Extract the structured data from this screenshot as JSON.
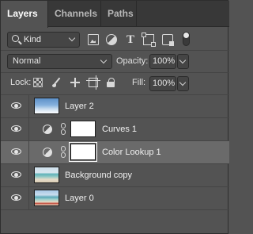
{
  "tabs": [
    {
      "label": "Layers",
      "active": true
    },
    {
      "label": "Channels",
      "active": false
    },
    {
      "label": "Paths",
      "active": false
    }
  ],
  "filter": {
    "kind_label": "Kind",
    "icons": [
      "pixel-filter-icon",
      "adjustment-filter-icon",
      "type-filter-icon",
      "shape-filter-icon",
      "smart-object-filter-icon",
      "filter-toggle-icon"
    ],
    "type_glyph": "T"
  },
  "blend": {
    "mode": "Normal",
    "opacity_label": "Opacity:",
    "opacity_value": "100%"
  },
  "lock": {
    "label": "Lock:",
    "icons": [
      "lock-transparent-icon",
      "lock-pixels-icon",
      "lock-position-icon",
      "lock-artboard-icon",
      "lock-all-icon"
    ],
    "fill_label": "Fill:",
    "fill_value": "100%"
  },
  "layers": [
    {
      "name": "Layer 2",
      "kind": "pixel",
      "visible": true,
      "selected": false
    },
    {
      "name": "Curves 1",
      "kind": "adjustment",
      "visible": true,
      "selected": false
    },
    {
      "name": "Color Lookup 1",
      "kind": "adjustment",
      "visible": true,
      "selected": true
    },
    {
      "name": "Background copy",
      "kind": "pixel",
      "visible": true,
      "selected": false
    },
    {
      "name": "Layer 0",
      "kind": "pixel",
      "visible": true,
      "selected": false
    }
  ],
  "colors": {
    "panel_bg": "#535353",
    "tabbar_bg": "#383838",
    "selected_row": "#6a6a6a",
    "text": "#f0f0f0"
  }
}
